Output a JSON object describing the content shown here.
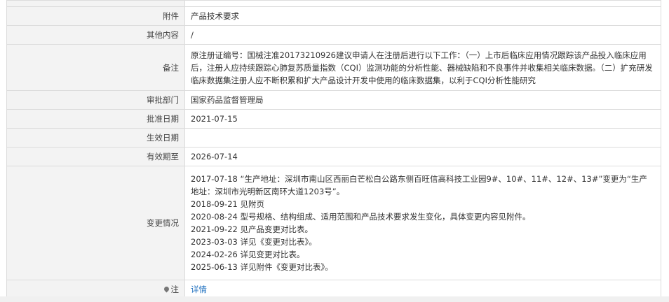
{
  "rows": {
    "attachment": {
      "label": "附件",
      "value": "产品技术要求"
    },
    "other_content": {
      "label": "其他内容",
      "value": "/"
    },
    "remark": {
      "label": "备注",
      "value": "原注册证编号：国械注准20173210926建议申请人在注册后进行以下工作：（一）上市后临床应用情况跟踪该产品投入临床应用后，注册人应持续跟踪心肺复苏质量指数（CQI）监测功能的分析性能、器械缺陷和不良事件并收集相关临床数据。（二）扩充研发临床数据集注册人应不断积累和扩大产品设计开发中使用的临床数据集，以利于CQI分析性能研究"
    },
    "approval_dept": {
      "label": "审批部门",
      "value": "国家药品监督管理局"
    },
    "approval_date": {
      "label": "批准日期",
      "value": "2021-07-15"
    },
    "effective_date": {
      "label": "生效日期",
      "value": ""
    },
    "valid_until": {
      "label": "有效期至",
      "value": "2026-07-14"
    },
    "changes": {
      "label": "变更情况",
      "lines": [
        "2017-07-18 “生产地址：深圳市南山区西丽白芒松白公路东侧百旺信高科技工业园9#、10#、11#、12#、13#”变更为“生产地址：深圳市光明新区南环大道1203号”。",
        "2018-09-21 见附页",
        "2020-08-24 型号规格、结构组成、适用范围和产品技术要求发生变化，具体变更内容见附件。",
        "2021-09-22 见产品变更对比表。",
        "2023-03-03 详见《变更对比表》。",
        "2024-02-26 详见变更对比表。",
        "2025-06-13 详见附件《变更对比表》。"
      ]
    },
    "note": {
      "label": "注",
      "link": "详情",
      "icon": "map-pin-icon"
    }
  }
}
